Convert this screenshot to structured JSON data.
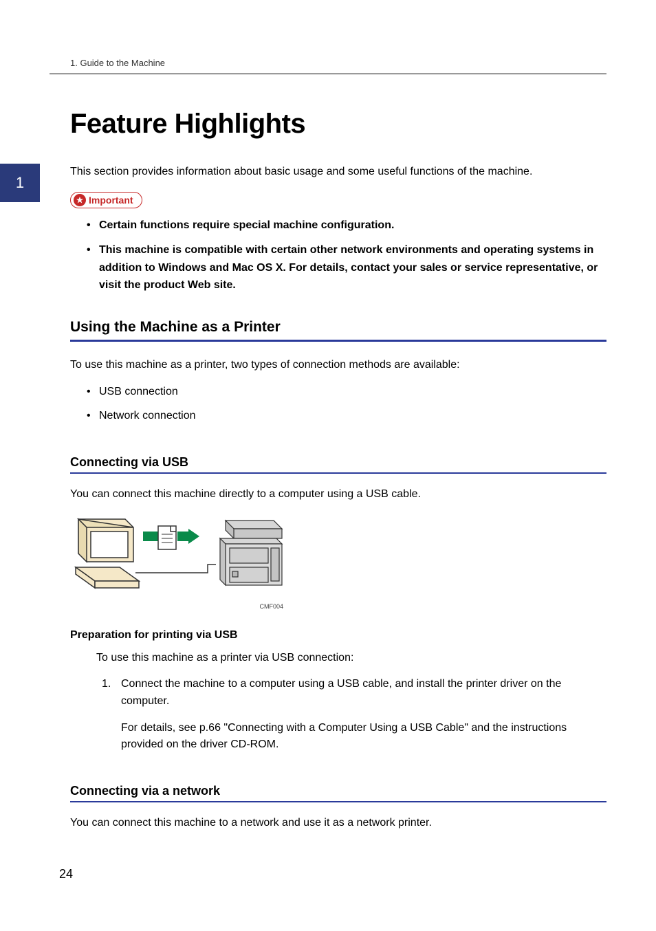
{
  "header": {
    "breadcrumb": "1. Guide to the Machine"
  },
  "chapterTab": "1",
  "title": "Feature Highlights",
  "intro": "This section provides information about basic usage and some useful functions of the machine.",
  "important": {
    "label": "Important",
    "items": [
      "Certain functions require special machine configuration.",
      "This machine is compatible with certain other network environments and operating systems in addition to Windows and Mac OS X. For details, contact your sales or service representative, or visit the product Web site."
    ]
  },
  "section1": {
    "heading": "Using the Machine as a Printer",
    "intro": "To use this machine as a printer, two types of connection methods are available:",
    "bullets": [
      "USB connection",
      "Network connection"
    ]
  },
  "subUSB": {
    "heading": "Connecting via USB",
    "intro": "You can connect this machine directly to a computer using a USB cable.",
    "figureCaption": "CMF004",
    "prepHeading": "Preparation for printing via USB",
    "prepIntro": "To use this machine as a printer via USB connection:",
    "steps": [
      {
        "main": "Connect the machine to a computer using a USB cable, and install the printer driver on the computer.",
        "sub": "For details, see p.66 \"Connecting with a Computer Using a USB Cable\" and the instructions provided on the driver CD-ROM."
      }
    ]
  },
  "subNetwork": {
    "heading": "Connecting via a network",
    "intro": "You can connect this machine to a network and use it as a network printer."
  },
  "pageNumber": "24"
}
